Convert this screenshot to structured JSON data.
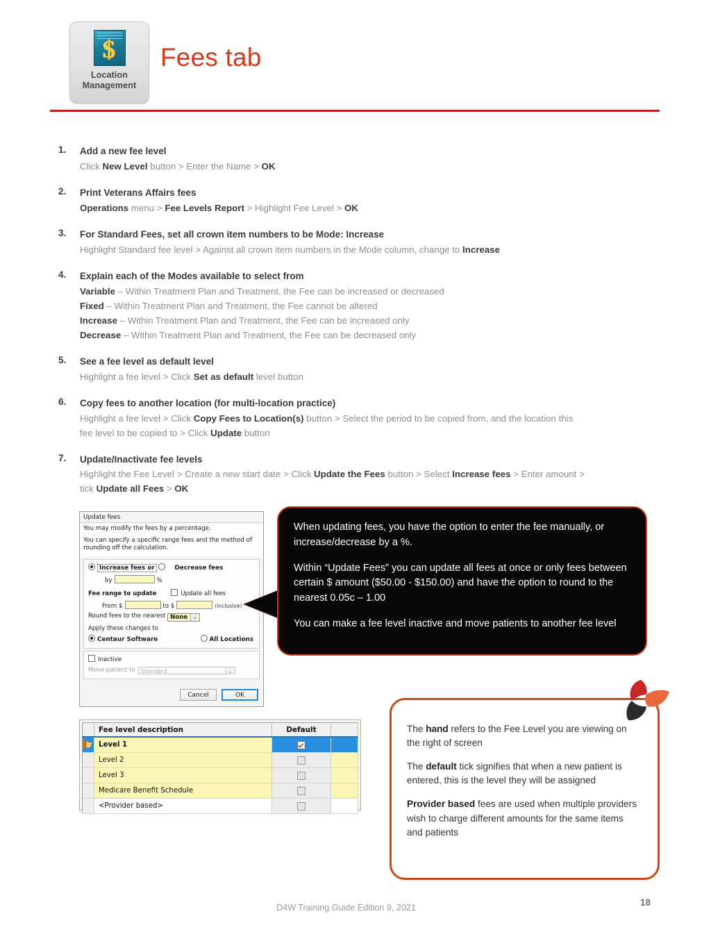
{
  "header": {
    "app_icon_label_line1": "Location",
    "app_icon_label_line2": "Management",
    "app_icon_symbol": "$",
    "title": "Fees tab"
  },
  "steps": [
    {
      "num": "1.",
      "title": "Add a new fee level",
      "lines": [
        [
          {
            "t": "Click ",
            "b": false
          },
          {
            "t": "New Level",
            "b": true
          },
          {
            "t": " button > Enter the Name > ",
            "b": false
          },
          {
            "t": "OK",
            "b": true
          }
        ]
      ]
    },
    {
      "num": "2.",
      "title": "Print Veterans Affairs fees",
      "lines": [
        [
          {
            "t": "Operations",
            "b": true
          },
          {
            "t": " menu > ",
            "b": false
          },
          {
            "t": "Fee Levels Report",
            "b": true
          },
          {
            "t": " > Highlight Fee Level > ",
            "b": false
          },
          {
            "t": "OK",
            "b": true
          }
        ]
      ]
    },
    {
      "num": "3.",
      "title": "For Standard Fees, set all crown item numbers to be Mode: Increase",
      "lines": [
        [
          {
            "t": "Highlight Standard fee level > Against all crown item numbers in the Mode column, change to ",
            "b": false
          },
          {
            "t": "Increase",
            "b": true
          }
        ]
      ]
    },
    {
      "num": "4.",
      "title": "Explain each of the Modes available to select from",
      "lines": [
        [
          {
            "t": "Variable",
            "b": true
          },
          {
            "t": " – Within Treatment Plan and Treatment, the Fee can be increased or decreased",
            "b": false
          }
        ],
        [
          {
            "t": "Fixed",
            "b": true
          },
          {
            "t": " – Within Treatment Plan and Treatment, the Fee cannot be altered",
            "b": false
          }
        ],
        [
          {
            "t": "Increase",
            "b": true
          },
          {
            "t": " – Within Treatment Plan and Treatment, the Fee can be increased only",
            "b": false
          }
        ],
        [
          {
            "t": "Decrease",
            "b": true
          },
          {
            "t": " – Within Treatment Plan and Treatment, the Fee can be decreased only",
            "b": false
          }
        ]
      ]
    },
    {
      "num": "5.",
      "title": "See a fee level as default level",
      "lines": [
        [
          {
            "t": "Highlight a fee level > Click ",
            "b": false
          },
          {
            "t": "Set as default",
            "b": true
          },
          {
            "t": " level button",
            "b": false
          }
        ]
      ]
    },
    {
      "num": "6.",
      "title": "Copy fees to another location (for multi-location practice)",
      "lines": [
        [
          {
            "t": "Highlight a fee level > Click ",
            "b": false
          },
          {
            "t": "Copy Fees to Location(s)",
            "b": true
          },
          {
            "t": " button > Select the period to be copied from, and the location this",
            "b": false
          }
        ],
        [
          {
            "t": "fee level to be copied to > Click ",
            "b": false
          },
          {
            "t": "Update",
            "b": true
          },
          {
            "t": " button",
            "b": false
          }
        ]
      ]
    },
    {
      "num": "7.",
      "title": "Update/Inactivate fee levels",
      "lines": [
        [
          {
            "t": "Highlight the Fee Level > Create a new start date > Click ",
            "b": false
          },
          {
            "t": "Update the Fees",
            "b": true
          },
          {
            "t": " button > Select ",
            "b": false
          },
          {
            "t": "Increase fees",
            "b": true
          },
          {
            "t": " > Enter amount >",
            "b": false
          }
        ],
        [
          {
            "t": "tick ",
            "b": false
          },
          {
            "t": "Update all Fees",
            "b": true
          },
          {
            "t": " > ",
            "b": false
          },
          {
            "t": "OK",
            "b": true
          }
        ]
      ]
    }
  ],
  "dialog": {
    "title": "Update fees",
    "intro_line1": "You may modify the fees by a percentage.",
    "intro_line2": "You can specify a specific range fees and the method of rounding off the calculation.",
    "increase_label": "Increase fees  or",
    "decrease_label": "Decrease fees",
    "by_label": "by",
    "by_value": "",
    "percent_sign": "%",
    "fee_range_label": "Fee range to update",
    "update_all_label": "Update all fees",
    "from_label": "From $",
    "from_value": "",
    "to_label": "to $",
    "to_value": "",
    "inclusive_label": "(inclusive)",
    "round_label": "Round fees to the nearest",
    "round_value": "None",
    "apply_label": "Apply these changes to",
    "apply_opt1": "Centaur Software",
    "apply_opt2": "All Locations",
    "inactive_label": "Inactive",
    "move_patient_label": "Move patient to",
    "move_patient_value": "Standard",
    "cancel_button": "Cancel",
    "ok_button": "OK"
  },
  "black_callout": {
    "p1": "When updating fees, you have the option to enter the fee manually, or increase/decrease by a %.",
    "p2": "Within “Update Fees” you can update all fees at once or only fees between certain $ amount ($50.00 - $150.00) and have the option to round to the nearest 0.05c – 1.00",
    "p3": "You can make a fee level inactive and move patients to another fee level"
  },
  "fee_table": {
    "columns": [
      "Fee level description",
      "Default"
    ],
    "rows": [
      {
        "description": "Level 1",
        "default_checked": true,
        "selected": true,
        "highlighted": true
      },
      {
        "description": "Level 2",
        "default_checked": false,
        "selected": false,
        "highlighted": true
      },
      {
        "description": "Level 3",
        "default_checked": false,
        "selected": false,
        "highlighted": true
      },
      {
        "description": "Medicare Benefit Schedule",
        "default_checked": false,
        "selected": false,
        "highlighted": true
      },
      {
        "description": "<Provider based>",
        "default_checked": false,
        "selected": false,
        "highlighted": false
      }
    ]
  },
  "orange_callout": {
    "p1": [
      {
        "t": "The ",
        "b": false
      },
      {
        "t": "hand",
        "b": true
      },
      {
        "t": " refers to the Fee Level you are viewing on the right of screen",
        "b": false
      }
    ],
    "p2": [
      {
        "t": "The ",
        "b": false
      },
      {
        "t": "default",
        "b": true
      },
      {
        "t": " tick signifies that when a new patient is entered, this is the level they will be assigned",
        "b": false
      }
    ],
    "p3": [
      {
        "t": "Provider based",
        "b": true
      },
      {
        "t": " fees are used when multiple providers wish to charge different amounts for the same items and patients",
        "b": false
      }
    ]
  },
  "footer": {
    "text": "D4W Training Guide Edition 9, 2021",
    "page_number": "18"
  },
  "colors": {
    "title_red": "#d1391a",
    "rule_red": "#b42121",
    "callout_orange": "#c8481c",
    "black_callout_bg": "#080808",
    "selection_blue": "#2a8fe0",
    "field_yellow": "#fcf6c2",
    "row_yellow": "#fcf6b6"
  }
}
